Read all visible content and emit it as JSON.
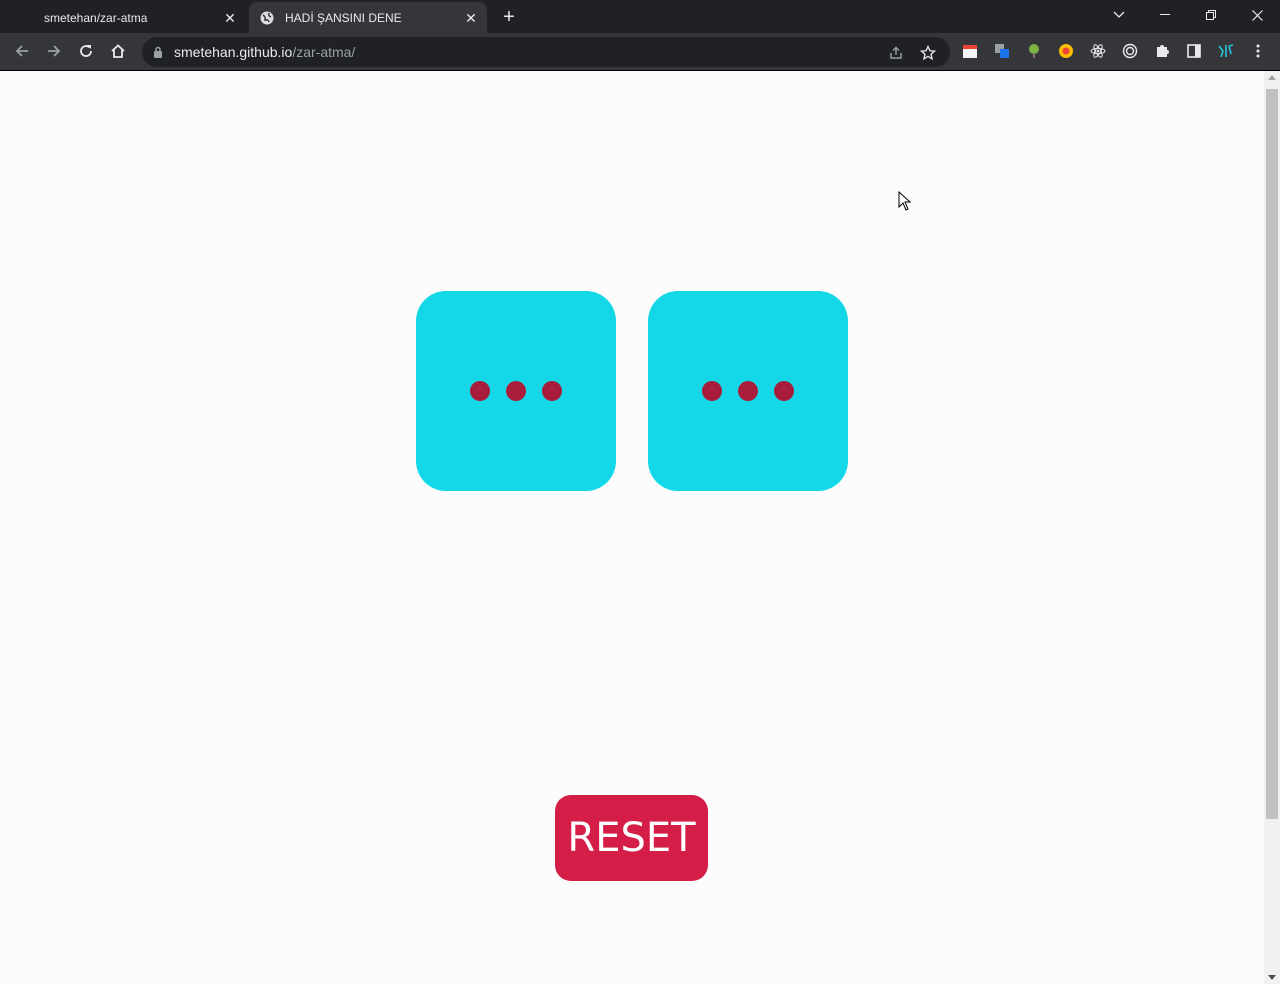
{
  "browser": {
    "tabs": [
      {
        "title": "smetehan/zar-atma",
        "active": false,
        "icon": "github-icon"
      },
      {
        "title": "HADİ ŞANSINI DENE",
        "active": true,
        "icon": "globe-icon"
      }
    ],
    "new_tab_label": "+",
    "url_host": "smetehan.github.io",
    "url_path": "/zar-atma/"
  },
  "page": {
    "dice": [
      {
        "pips": 3,
        "label": "die-1"
      },
      {
        "pips": 3,
        "label": "die-2"
      }
    ],
    "reset_label": "RESET"
  },
  "colors": {
    "die_bg": "#14d8e8",
    "pip": "#a81d3b",
    "reset_bg": "#d41e48",
    "page_bg": "#fcfcfc"
  }
}
